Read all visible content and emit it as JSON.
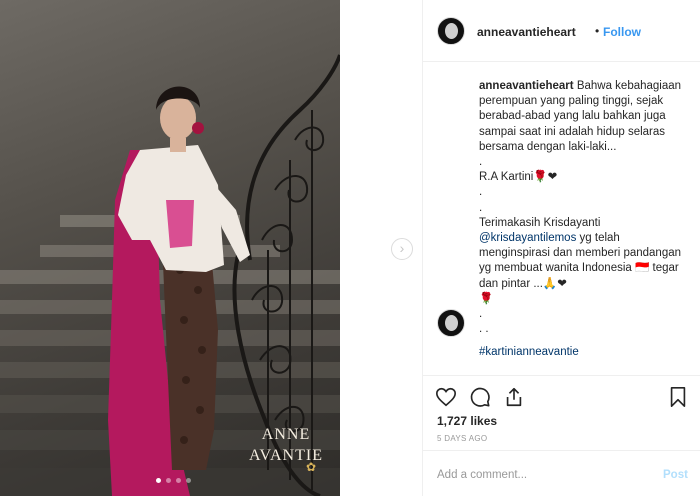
{
  "photo": {
    "brand_line1": "ANNE",
    "brand_line2": "AVANTIE",
    "brand_star": "✿",
    "carousel_dots": 4,
    "active_dot": 1
  },
  "nav": {
    "next_arrow": "›"
  },
  "header": {
    "username": "anneavantieheart",
    "separator": "•",
    "follow_label": "Follow"
  },
  "caption": {
    "username": "anneavantieheart",
    "text1": "Bahwa kebahagiaan perempuan yang paling tinggi, sejak berabad-abad yang lalu bahkan juga sampai saat ini adalah hidup selaras bersama dengan laki-laki...",
    "dot1": ".",
    "quote_author": "R.A Kartini🌹❤",
    "dot2": ".",
    "dot3": ".",
    "thanks": "Terimakasih Krisdayanti",
    "mention": "@krisdayantilemos",
    "text2": "yg telah menginspirasi dan memberi pandangan yg membuat wanita Indonesia 🇮🇩 tegar dan pintar ...🙏❤",
    "rose": "🌹",
    "dot4": ".",
    "dot5": ". .",
    "hashtag": "#kartinianneavantie"
  },
  "actions": {
    "likes": "1,727 likes",
    "time": "5 DAYS AGO"
  },
  "comment_box": {
    "placeholder": "Add a comment...",
    "post_label": "Post"
  },
  "icons": [
    "heart-icon",
    "comment-icon",
    "share-icon",
    "bookmark-icon"
  ],
  "colors": {
    "link": "#3897f0",
    "post_disabled": "#b2dffc",
    "hashtag": "#003569"
  }
}
